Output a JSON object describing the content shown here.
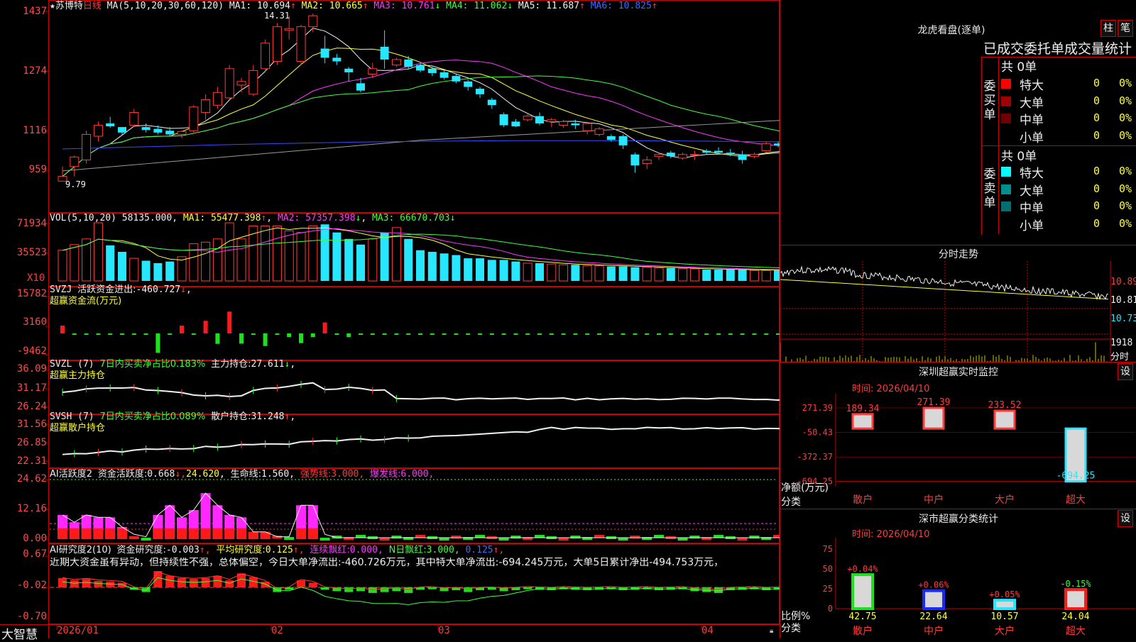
{
  "app_brand": "大智慧",
  "stock": {
    "name": "★苏博特",
    "period": "日线",
    "ma_params": "MA(5,10,20,30,60,120)",
    "ma_values": [
      {
        "label": "MA1:",
        "value": "10.694",
        "arrow": "↑",
        "color": "#f0f0f0"
      },
      {
        "label": "MA2:",
        "value": "10.665",
        "arrow": "↑",
        "color": "#ffff3a"
      },
      {
        "label": "MA3:",
        "value": "10.761",
        "arrow": "↓",
        "color": "#ff37ff"
      },
      {
        "label": "MA4:",
        "value": "11.062",
        "arrow": "↓",
        "color": "#3cff3c"
      },
      {
        "label": "MA5:",
        "value": "11.687",
        "arrow": "↑",
        "color": "#f0f0f0"
      },
      {
        "label": "MA6:",
        "value": "10.825",
        "arrow": "↑",
        "color": "#3b6bff"
      }
    ],
    "price_axis": [
      "1437",
      "1274",
      "1116",
      "959"
    ],
    "high_marker": "14.31",
    "low_marker": "9.79"
  },
  "volume": {
    "header": "VOL(5,10,20)",
    "value": "58135.000",
    "ma": [
      {
        "label": "MA1:",
        "value": "55477.398",
        "arrow": "↑",
        "color": "#ffff3a"
      },
      {
        "label": "MA2:",
        "value": "57357.398",
        "arrow": "↓",
        "color": "#ff37ff"
      },
      {
        "label": "MA3:",
        "value": "66670.703",
        "arrow": "↓",
        "color": "#3cff3c"
      }
    ],
    "axis": [
      "71934",
      "35523"
    ],
    "unit": "X10"
  },
  "svzj": {
    "header": "SVZJ",
    "label": "活跃资金进出:",
    "value": "-460.727",
    "arrow": "↓",
    "subtitle": "超赢资金流(万元)",
    "axis": [
      "15782",
      "3160",
      "-9462"
    ]
  },
  "svzl": {
    "header": "SVZL (7)",
    "desc": "7日内买卖净占比0.183%",
    "label": "主力持仓:",
    "value": "27.611",
    "arrow": "↓",
    "subtitle": "超赢主力持仓",
    "axis": [
      "36.09",
      "31.17",
      "26.24"
    ]
  },
  "svsh": {
    "header": "SVSH (7)",
    "desc": "7日内买卖净占比0.089%",
    "label": "散户持仓:",
    "value": "31.248",
    "arrow": "↑",
    "subtitle": "超赢散户持仓",
    "axis": [
      "31.56",
      "26.85",
      "22.31"
    ]
  },
  "ai_active": {
    "header": "AI活跃度2",
    "label": "资金活跃度:",
    "value": "0.668",
    "val2": "24.620",
    "life_label": "生命线:",
    "life_value": "1.560",
    "strong_label": "强势线:",
    "strong_value": "3.000",
    "burst_label": "爆发线:",
    "burst_value": "6.000",
    "axis": [
      "24.62",
      "12.16",
      "0.00"
    ]
  },
  "ai_research": {
    "header": "AI研究度2(10)",
    "label": "资金研究度:",
    "value": "-0.003",
    "avg_label": "平均研究度:",
    "avg_value": "0.125",
    "lianxu_label": "连续飘红:",
    "lianxu_value": "0.000",
    "n_label": "N日飘红:",
    "n_value": "3.000",
    "n_value2": "0.125",
    "comment": "近期大资金虽有异动，但持续性不强，总体偏空，今日大单净流出:-460.726万元，其中特大单净流出:-694.245万元，大单5日累计净出-494.753万元，",
    "axis": [
      "0.67",
      "-0.02",
      "-0.70"
    ]
  },
  "date_axis": [
    "2026/01",
    "02",
    "03",
    "04"
  ],
  "right": {
    "longhu": {
      "title": "龙虎看盘(逐单)",
      "btn1": "柱",
      "btn2": "笔",
      "subtitle": "已成交委托单成交量统计",
      "buy_side": "委买单",
      "sell_side": "委卖单",
      "buy_total": "共 0单",
      "sell_total": "共 0单",
      "buy_rows": [
        {
          "label": "特大",
          "count": "0",
          "pct": "0%",
          "color": "#ff0000"
        },
        {
          "label": "大单",
          "count": "0",
          "pct": "0%",
          "color": "#a00000"
        },
        {
          "label": "中单",
          "count": "0",
          "pct": "0%",
          "color": "#700000"
        },
        {
          "label": "小单",
          "count": "0",
          "pct": "0%",
          "color": ""
        }
      ],
      "sell_rows": [
        {
          "label": "特大",
          "count": "0",
          "pct": "0%",
          "color": "#00ffff"
        },
        {
          "label": "大单",
          "count": "0",
          "pct": "0%",
          "color": "#008f8f"
        },
        {
          "label": "中单",
          "count": "0",
          "pct": "0%",
          "color": "#006f6f"
        },
        {
          "label": "小单",
          "count": "0",
          "pct": "0%",
          "color": ""
        }
      ]
    },
    "intraday": {
      "title": "分时走势",
      "axis": [
        "10.89",
        "10.81",
        "10.73"
      ],
      "vol_max": "1918",
      "vol_unit": "分时"
    },
    "sz_monitor": {
      "title": "深圳超赢实时监控",
      "btn": "设",
      "time_label": "时间: 2026/04/10",
      "axis": [
        "271.39",
        "-50.43",
        "-372.37",
        "-694.25"
      ],
      "ylabel": "净额(万元)",
      "xlabel": "分类",
      "categories": [
        "散户",
        "中户",
        "大户",
        "超大"
      ],
      "values_text": [
        "189.34",
        "271.39",
        "233.52",
        "-694.25"
      ]
    },
    "sz_category": {
      "title": "深市超赢分类统计",
      "btn": "设",
      "time_label": "时间: 2026/04/10",
      "axis": [
        "75",
        "50",
        "25",
        "0"
      ],
      "ylabel": "比例%",
      "xlabel": "分类",
      "categories": [
        "散户",
        "中户",
        "大户",
        "超大"
      ],
      "values_text": [
        "42.75",
        "22.64",
        "10.57",
        "24.04"
      ],
      "change_text": [
        "+0.04%",
        "+0.06%",
        "+0.05%",
        "-0.15%"
      ]
    }
  },
  "chart_data": [
    {
      "type": "candlestick",
      "title": "★苏博特 日线",
      "ylim": [
        9.59,
        14.37
      ],
      "ohlc": [
        [
          9.72,
          10.12,
          9.79,
          9.85
        ],
        [
          10.12,
          10.42,
          9.85,
          10.38
        ],
        [
          10.3,
          11.1,
          10.2,
          11.0
        ],
        [
          10.95,
          11.35,
          10.8,
          11.25
        ],
        [
          11.3,
          11.48,
          11.18,
          11.22
        ],
        [
          11.2,
          11.2,
          10.98,
          11.05
        ],
        [
          11.25,
          11.7,
          11.2,
          11.6
        ],
        [
          11.2,
          11.3,
          11.05,
          11.12
        ],
        [
          11.15,
          11.25,
          11.0,
          11.05
        ],
        [
          11.1,
          11.2,
          10.95,
          11.0
        ],
        [
          11.0,
          11.1,
          10.9,
          11.08
        ],
        [
          11.1,
          11.8,
          11.05,
          11.75
        ],
        [
          11.6,
          12.1,
          11.4,
          11.95
        ],
        [
          11.8,
          12.3,
          11.7,
          12.15
        ],
        [
          12.0,
          12.9,
          11.95,
          12.8
        ],
        [
          12.35,
          12.55,
          12.15,
          12.45
        ],
        [
          12.1,
          12.9,
          12.05,
          12.75
        ],
        [
          12.8,
          13.6,
          12.7,
          13.5
        ],
        [
          13.0,
          14.05,
          12.9,
          13.95
        ],
        [
          13.85,
          14.25,
          13.6,
          13.9
        ],
        [
          13.0,
          14.0,
          12.9,
          13.95
        ],
        [
          13.95,
          14.31,
          13.8,
          14.25
        ],
        [
          13.35,
          13.7,
          12.95,
          13.1
        ],
        [
          13.1,
          13.2,
          12.9,
          13.0
        ],
        [
          12.8,
          12.85,
          12.45,
          12.7
        ],
        [
          12.4,
          12.55,
          12.15,
          12.2
        ],
        [
          12.65,
          12.95,
          12.55,
          12.8
        ],
        [
          13.4,
          13.85,
          12.8,
          13.05
        ],
        [
          12.9,
          13.1,
          12.85,
          13.05
        ],
        [
          13.05,
          13.15,
          12.8,
          12.85
        ],
        [
          12.9,
          12.95,
          12.7,
          12.75
        ],
        [
          12.8,
          12.85,
          12.6,
          12.68
        ],
        [
          12.7,
          12.75,
          12.5,
          12.55
        ],
        [
          12.6,
          12.65,
          12.4,
          12.45
        ],
        [
          12.45,
          12.5,
          12.2,
          12.3
        ],
        [
          12.25,
          12.3,
          12.0,
          12.1
        ],
        [
          11.95,
          12.0,
          11.7,
          11.8
        ],
        [
          11.55,
          11.6,
          11.2,
          11.25
        ],
        [
          11.35,
          11.42,
          11.2,
          11.22
        ],
        [
          11.4,
          11.55,
          11.35,
          11.5
        ],
        [
          11.5,
          11.6,
          11.25,
          11.3
        ],
        [
          11.35,
          11.45,
          11.2,
          11.4
        ],
        [
          11.25,
          11.4,
          11.18,
          11.35
        ],
        [
          11.3,
          11.4,
          11.15,
          11.25
        ],
        [
          11.1,
          11.35,
          11.0,
          11.3
        ],
        [
          11.0,
          11.2,
          10.95,
          11.15
        ],
        [
          10.95,
          11.0,
          10.8,
          10.85
        ],
        [
          10.95,
          11.0,
          10.6,
          10.7
        ],
        [
          10.45,
          10.5,
          9.95,
          10.15
        ],
        [
          10.2,
          10.4,
          10.05,
          10.3
        ],
        [
          10.4,
          10.5,
          10.3,
          10.45
        ],
        [
          10.5,
          10.55,
          10.35,
          10.4
        ],
        [
          10.35,
          10.5,
          10.3,
          10.45
        ],
        [
          10.45,
          10.55,
          10.3,
          10.45
        ],
        [
          10.55,
          10.6,
          10.45,
          10.5
        ],
        [
          10.55,
          10.65,
          10.45,
          10.5
        ],
        [
          10.5,
          10.6,
          10.4,
          10.45
        ],
        [
          10.45,
          10.55,
          10.2,
          10.3
        ],
        [
          10.4,
          10.5,
          10.35,
          10.45
        ],
        [
          10.55,
          10.8,
          10.5,
          10.75
        ],
        [
          10.75,
          10.8,
          10.65,
          10.7
        ],
        [
          10.72,
          10.78,
          10.62,
          10.69
        ]
      ]
    },
    {
      "type": "bar",
      "title": "VOL(5,10,20)",
      "values": [
        38000,
        45000,
        52000,
        71934,
        44000,
        36000,
        28000,
        25000,
        22000,
        24000,
        30000,
        46000,
        48000,
        52000,
        71934,
        52000,
        68000,
        68000,
        68000,
        62000,
        60000,
        68000,
        70000,
        60000,
        52000,
        45000,
        52000,
        60000,
        66000,
        52000,
        38000,
        36000,
        34000,
        32000,
        28000,
        28000,
        26000,
        26000,
        24000,
        22000,
        22000,
        21000,
        20000,
        20000,
        19000,
        19000,
        18000,
        18000,
        17000,
        17000,
        16000,
        16000,
        15000,
        15000,
        14000,
        14000,
        14000,
        14000,
        13000,
        13000,
        13500,
        13000
      ]
    },
    {
      "type": "bar",
      "title": "SVZJ 超赢资金流(万元)",
      "values": [
        3200,
        -460,
        -460,
        -620,
        -600,
        -520,
        -540,
        -600,
        -8000,
        -560,
        3200,
        -420,
        5200,
        -4300,
        9000,
        -4200,
        -560,
        -5200,
        -560,
        -1500,
        -4000,
        -1500,
        4500,
        -600,
        -1500,
        -460,
        -460,
        -460,
        -460,
        -460,
        -460,
        -460,
        -460,
        -460,
        -460,
        -460,
        -460,
        -460,
        -460,
        -460,
        -460,
        -460,
        -460,
        -460,
        -460,
        -460,
        -460,
        -460,
        -460,
        -460,
        -460,
        -460,
        -460,
        -460,
        -460,
        -460,
        -460,
        -460,
        -460,
        -460,
        -460,
        -460
      ]
    },
    {
      "type": "bar",
      "title": "深圳超赢实时监控",
      "categories": [
        "散户",
        "中户",
        "大户",
        "超大"
      ],
      "values": [
        189.34,
        271.39,
        233.52,
        -694.25
      ],
      "ylim": [
        -694.25,
        271.39
      ]
    },
    {
      "type": "bar",
      "title": "深市超赢分类统计",
      "categories": [
        "散户",
        "中户",
        "大户",
        "超大"
      ],
      "values": [
        42.75,
        22.64,
        10.57,
        24.04
      ],
      "ylim": [
        0,
        75
      ]
    }
  ]
}
